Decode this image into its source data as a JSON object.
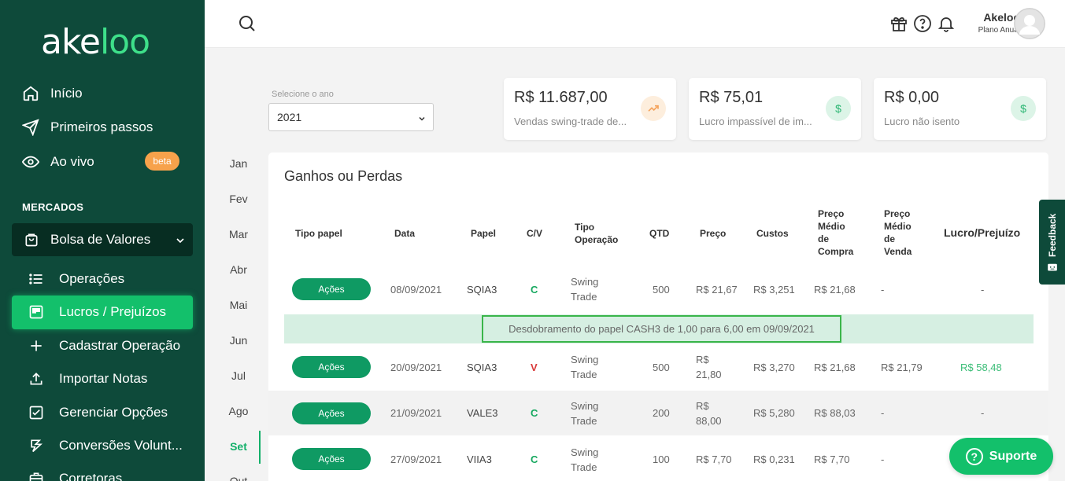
{
  "brand": {
    "part1": "ake",
    "part2": "loo"
  },
  "sidebar": {
    "items": [
      {
        "label": "Início",
        "icon": "home-icon"
      },
      {
        "label": "Primeiros passos",
        "icon": "send-icon"
      },
      {
        "label": "Ao vivo",
        "icon": "eye-icon",
        "badge": "beta"
      }
    ],
    "section_title": "MERCADOS",
    "market": "Bolsa de Valores",
    "sub_items": [
      {
        "label": "Operações",
        "icon": "list-icon"
      },
      {
        "label": "Lucros / Prejuízos",
        "icon": "board-icon",
        "active": true
      },
      {
        "label": "Cadastrar Operação",
        "icon": "plus-icon"
      },
      {
        "label": "Importar Notas",
        "icon": "upload-icon"
      },
      {
        "label": "Gerenciar Opções",
        "icon": "checkbox-icon"
      },
      {
        "label": "Conversões Volunt...",
        "icon": "convert-icon"
      },
      {
        "label": "Corretoras",
        "icon": "briefcase-icon"
      }
    ]
  },
  "header": {
    "user_name": "Akeloo",
    "user_plan": "Plano Anual"
  },
  "year": {
    "label": "Selecione o ano",
    "value": "2021"
  },
  "cards": [
    {
      "value": "R$ 11.687,00",
      "label": "Vendas swing-trade de...",
      "icon": "trending-up-icon",
      "color": "#f5a35c",
      "bg": "#fdeedd"
    },
    {
      "value": "R$ 75,01",
      "label": "Lucro impassível de im...",
      "icon": "dollar-icon",
      "color": "#2bb673",
      "bg": "#dcf4e7"
    },
    {
      "value": "R$ 0,00",
      "label": "Lucro não isento",
      "icon": "dollar-icon",
      "color": "#2bb673",
      "bg": "#dcf4e7"
    }
  ],
  "months": [
    "Jan",
    "Fev",
    "Mar",
    "Abr",
    "Mai",
    "Jun",
    "Jul",
    "Ago",
    "Set",
    "Out"
  ],
  "active_month": "Set",
  "panel": {
    "title": "Ganhos ou Perdas",
    "columns": {
      "tipo_papel": "Tipo papel",
      "data": "Data",
      "papel": "Papel",
      "cv": "C/V",
      "tipo_op_1": "Tipo",
      "tipo_op_2": "Operação",
      "qtd": "QTD",
      "preco": "Preço",
      "custos": "Custos",
      "pmc_1": "Preço",
      "pmc_2": "Médio",
      "pmc_3": "de",
      "pmc_4": "Compra",
      "pmv_1": "Preço",
      "pmv_2": "Médio",
      "pmv_3": "de",
      "pmv_4": "Venda",
      "lucro": "Lucro/Prejuízo"
    },
    "rows": [
      {
        "tipo": "Ações",
        "data": "08/09/2021",
        "papel": "SQIA3",
        "cv": "C",
        "op1": "Swing",
        "op2": "Trade",
        "qtd": "500",
        "preco1": "R$ 21,67",
        "preco2": "",
        "custos": "R$ 3,251",
        "pmc": "R$ 21,68",
        "pmv": "-",
        "lucro": "-"
      },
      {
        "tipo": "Ações",
        "data": "20/09/2021",
        "papel": "SQIA3",
        "cv": "V",
        "op1": "Swing",
        "op2": "Trade",
        "qtd": "500",
        "preco1": "R$",
        "preco2": "21,80",
        "custos": "R$ 3,270",
        "pmc": "R$ 21,68",
        "pmv": "R$ 21,79",
        "lucro": "R$ 58,48"
      },
      {
        "tipo": "Ações",
        "data": "21/09/2021",
        "papel": "VALE3",
        "cv": "C",
        "op1": "Swing",
        "op2": "Trade",
        "qtd": "200",
        "preco1": "R$",
        "preco2": "88,00",
        "custos": "R$ 5,280",
        "pmc": "R$ 88,03",
        "pmv": "-",
        "lucro": "-"
      },
      {
        "tipo": "Ações",
        "data": "27/09/2021",
        "papel": "VIIA3",
        "cv": "C",
        "op1": "Swing",
        "op2": "Trade",
        "qtd": "100",
        "preco1": "R$ 7,70",
        "preco2": "",
        "custos": "R$ 0,231",
        "pmc": "R$ 7,70",
        "pmv": "-",
        "lucro": ""
      }
    ],
    "notice": "Desdobramento do papel CASH3 de 1,00 para 6,00 em 09/09/2021"
  },
  "feedback": "Feedback",
  "support": "Suporte"
}
